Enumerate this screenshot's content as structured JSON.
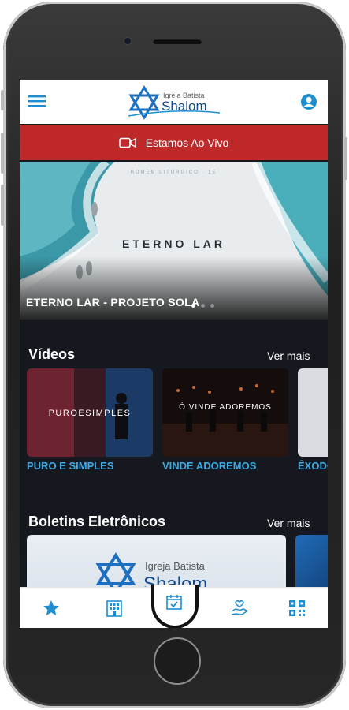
{
  "header": {
    "logo_line1": "Igreja Batista",
    "logo_line2": "Shalom"
  },
  "live": {
    "label": "Estamos Ao Vivo",
    "icon": "video-camera-icon"
  },
  "hero": {
    "small_text": "HOMEM LITÚRGICO · 1E",
    "title": "ETERNO LAR",
    "caption": "ETERNO LAR - PROJETO SOLA",
    "slides": 3,
    "active_slide": 1
  },
  "videos": {
    "title": "Vídeos",
    "see_more": "Ver mais",
    "items": [
      {
        "label": "PURO E SIMPLES",
        "thumb_text": "PUROESIMPLES"
      },
      {
        "label": "VINDE ADOREMOS",
        "thumb_text": "Ó VINDE ADOREMOS"
      },
      {
        "label": "ÊXODO"
      }
    ]
  },
  "bulletins": {
    "title": "Boletins Eletrônicos",
    "see_more": "Ver mais",
    "card_line1": "Igreja Batista",
    "card_line2": "Shalom"
  },
  "bottom_nav": {
    "items": [
      "star-icon",
      "building-icon",
      "calendar-check-icon",
      "hand-heart-icon",
      "qr-code-icon"
    ],
    "active": "calendar-check-icon"
  },
  "colors": {
    "accent": "#1d8fd1",
    "live_bar": "#c0292a",
    "background": "#15181f",
    "video_label": "#3fa9e0"
  }
}
